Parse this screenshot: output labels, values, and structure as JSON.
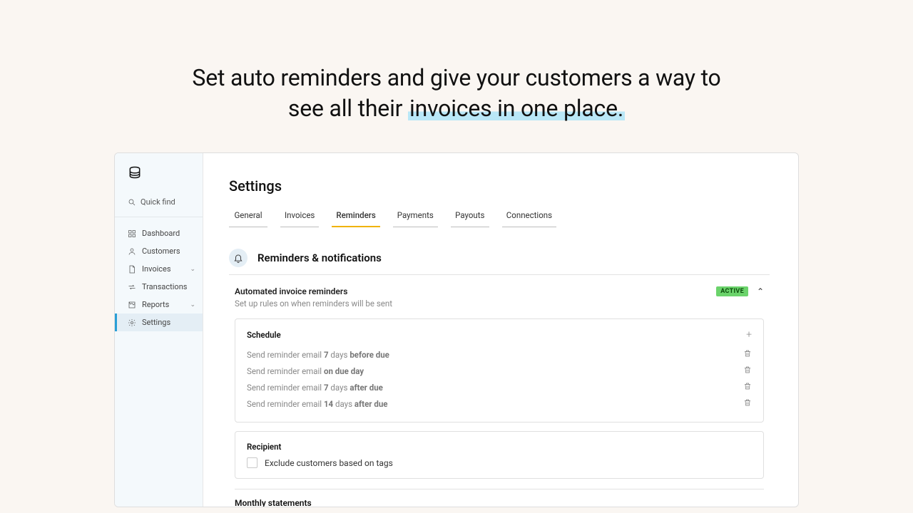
{
  "hero": {
    "line1": "Set auto reminders and give your customers a way to",
    "line2_pre": "see all their ",
    "line2_hl": "invoices in one place."
  },
  "sidebar": {
    "quick_find": "Quick find",
    "items": [
      {
        "label": "Dashboard"
      },
      {
        "label": "Customers"
      },
      {
        "label": "Invoices",
        "expandable": true
      },
      {
        "label": "Transactions"
      },
      {
        "label": "Reports",
        "expandable": true
      },
      {
        "label": "Settings",
        "active": true
      }
    ]
  },
  "main": {
    "title": "Settings",
    "tabs": [
      "General",
      "Invoices",
      "Reminders",
      "Payments",
      "Payouts",
      "Connections"
    ],
    "active_tab": "Reminders",
    "section_title": "Reminders & notifications",
    "auto": {
      "title": "Automated invoice reminders",
      "subtitle": "Set up rules on when reminders will be sent",
      "badge": "ACTIVE"
    },
    "schedule": {
      "title": "Schedule",
      "rows": [
        {
          "prefix": "Send reminder email ",
          "num": "7",
          "mid": " days ",
          "bold": "before due"
        },
        {
          "prefix": "Send reminder email ",
          "num": "",
          "mid": "",
          "bold": "on due day"
        },
        {
          "prefix": "Send reminder email ",
          "num": "7",
          "mid": " days ",
          "bold": "after due"
        },
        {
          "prefix": "Send reminder email ",
          "num": "14",
          "mid": " days ",
          "bold": "after due"
        }
      ]
    },
    "recipient": {
      "title": "Recipient",
      "checkbox_label": "Exclude customers based on tags"
    },
    "monthly": {
      "title": "Monthly statements"
    }
  }
}
